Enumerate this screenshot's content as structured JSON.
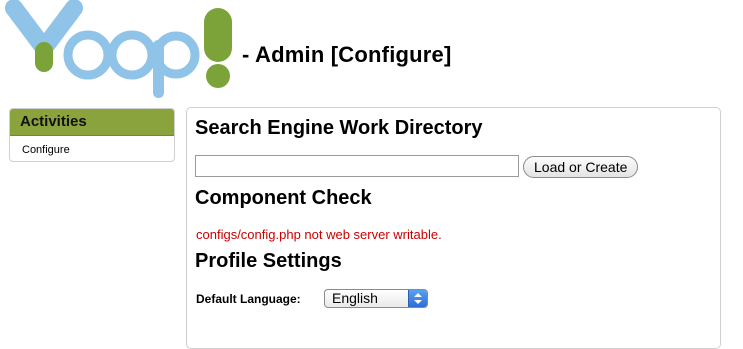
{
  "header": {
    "logo_text": "Yoop!",
    "title": "- Admin [Configure]"
  },
  "sidebar": {
    "heading": "Activities",
    "items": [
      {
        "label": "Configure"
      }
    ]
  },
  "main": {
    "work_dir": {
      "heading": "Search Engine Work Directory",
      "input_value": "",
      "button_label": "Load or Create"
    },
    "component_check": {
      "heading": "Component Check",
      "message": "configs/config.php not web server writable.",
      "message_color": "#cc0000"
    },
    "profile": {
      "heading": "Profile Settings",
      "language_label": "Default Language:",
      "language_selected": "English"
    }
  },
  "colors": {
    "brand_green": "#8aa33c",
    "logo_blue": "#8fc4e8",
    "logo_green": "#7ca33a"
  }
}
